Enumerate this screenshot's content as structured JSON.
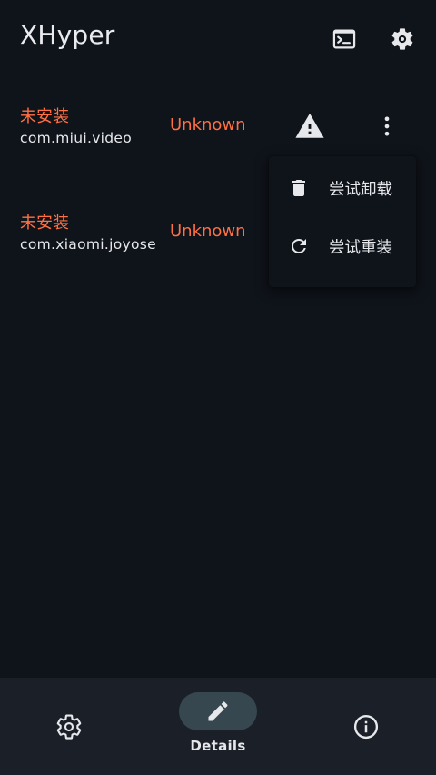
{
  "app": {
    "title": "XHyper"
  },
  "header": {
    "terminal_icon": "terminal-icon",
    "settings_icon": "gear-icon"
  },
  "modules": [
    {
      "status": "未安装",
      "package": "com.miui.video",
      "version": "Unknown",
      "warning_icon": "warning-icon",
      "more_icon": "more-vert-icon"
    },
    {
      "status": "未安装",
      "package": "com.xiaomi.joyose",
      "version": "Unknown"
    }
  ],
  "menu": {
    "items": [
      {
        "icon": "delete-icon",
        "label": "尝试卸载"
      },
      {
        "icon": "refresh-icon",
        "label": "尝试重装"
      }
    ]
  },
  "bottom_nav": {
    "items": [
      {
        "icon": "gear-icon",
        "label": ""
      },
      {
        "icon": "edit-icon",
        "label": "Details",
        "selected": true
      },
      {
        "icon": "info-icon",
        "label": ""
      }
    ]
  },
  "colors": {
    "background": "#0f131a",
    "accent_status": "#ff7043",
    "nav_background": "#1b1f27",
    "nav_pill": "#37474f",
    "text": "#e6e8ec"
  }
}
